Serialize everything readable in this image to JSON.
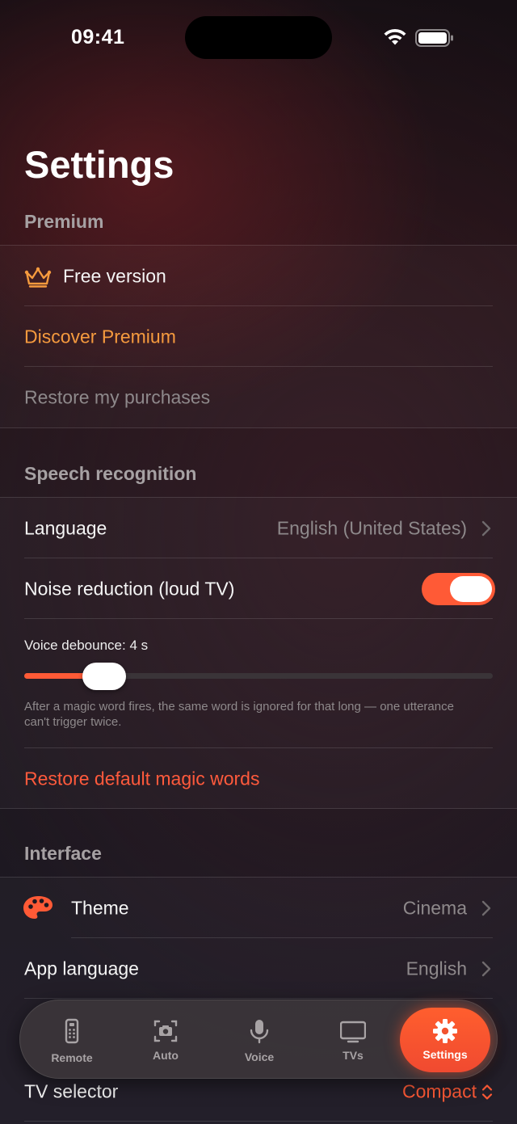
{
  "status_bar": {
    "time": "09:41"
  },
  "page": {
    "title": "Settings"
  },
  "premium": {
    "header": "Premium",
    "free_version": "Free version",
    "discover": "Discover Premium",
    "restore_purchases": "Restore my purchases"
  },
  "speech": {
    "header": "Speech recognition",
    "language_label": "Language",
    "language_value": "English (United States)",
    "noise_label": "Noise reduction (loud TV)",
    "noise_on": true,
    "debounce_label": "Voice debounce: 4 s",
    "debounce_level": 0.17,
    "debounce_help": "After a magic word fires, the same word is ignored for that long — one utterance can't trigger twice.",
    "restore_magic": "Restore default magic words"
  },
  "interface": {
    "header": "Interface",
    "theme_label": "Theme",
    "theme_value": "Cinema",
    "app_language_label": "App language",
    "app_language_value": "English",
    "tv_selector_label": "TV selector",
    "tv_selector_value": "Compact"
  },
  "tabbar": {
    "tabs": [
      {
        "label": "Remote",
        "icon": "remote-icon"
      },
      {
        "label": "Auto",
        "icon": "camera-scan-icon"
      },
      {
        "label": "Voice",
        "icon": "microphone-icon"
      },
      {
        "label": "TVs",
        "icon": "tv-icon"
      },
      {
        "label": "Settings",
        "icon": "gear-icon",
        "active": true
      }
    ]
  },
  "colors": {
    "accent": "#ff5a36",
    "premium_orange": "#f59a3e",
    "secondary_text": "#8e898b"
  }
}
